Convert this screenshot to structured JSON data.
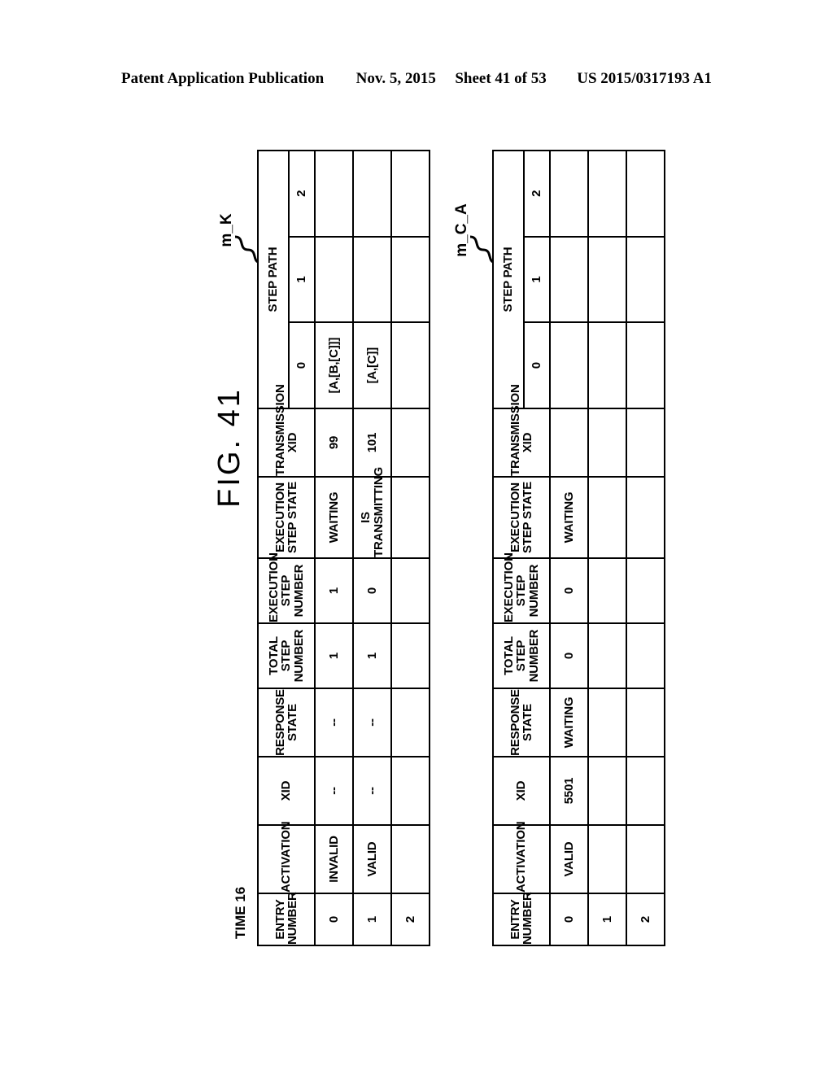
{
  "page_header": {
    "publication": "Patent Application Publication",
    "date": "Nov. 5, 2015",
    "sheet": "Sheet 41 of 53",
    "patent_number": "US 2015/0317193 A1"
  },
  "figure": {
    "title": "FIG. 41",
    "time_label": "TIME 16"
  },
  "colors": {
    "ink": "#000000",
    "paper": "#ffffff"
  },
  "tables": [
    {
      "ref_label": "m_K",
      "columns": {
        "entry_number": "ENTRY\nNUMBER",
        "activation": "ACTIVATION",
        "xid": "XID",
        "response_state": "RESPONSE\nSTATE",
        "total_step_number": "TOTAL\nSTEP\nNUMBER",
        "execution_step_number": "EXECUTION\nSTEP\nNUMBER",
        "execution_step_state": "EXECUTION\nSTEP STATE",
        "transmission_xid": "TRANSMISSION\nXID",
        "step_path": "STEP PATH",
        "step_path_sub": [
          "0",
          "1",
          "2"
        ]
      },
      "rows": [
        {
          "entry_number": "0",
          "activation": "INVALID",
          "xid": "--",
          "response_state": "--",
          "total_step_number": "1",
          "execution_step_number": "1",
          "execution_step_state": "WAITING",
          "transmission_xid": "99",
          "step_path": [
            "[A,[B,[C]]]",
            "",
            ""
          ]
        },
        {
          "entry_number": "1",
          "activation": "VALID",
          "xid": "--",
          "response_state": "--",
          "total_step_number": "1",
          "execution_step_number": "0",
          "execution_step_state": "IS\nTRANSMITTING",
          "transmission_xid": "101",
          "step_path": [
            "[A,[C]]",
            "",
            ""
          ]
        },
        {
          "entry_number": "2",
          "activation": "",
          "xid": "",
          "response_state": "",
          "total_step_number": "",
          "execution_step_number": "",
          "execution_step_state": "",
          "transmission_xid": "",
          "step_path": [
            "",
            "",
            ""
          ]
        }
      ]
    },
    {
      "ref_label": "m_C_A",
      "columns": {
        "entry_number": "ENTRY\nNUMBER",
        "activation": "ACTIVATION",
        "xid": "XID",
        "response_state": "RESPONSE\nSTATE",
        "total_step_number": "TOTAL\nSTEP\nNUMBER",
        "execution_step_number": "EXECUTION\nSTEP\nNUMBER",
        "execution_step_state": "EXECUTION\nSTEP STATE",
        "transmission_xid": "TRANSMISSION\nXID",
        "step_path": "STEP PATH",
        "step_path_sub": [
          "0",
          "1",
          "2"
        ]
      },
      "rows": [
        {
          "entry_number": "0",
          "activation": "VALID",
          "xid": "5501",
          "response_state": "WAITING",
          "total_step_number": "0",
          "execution_step_number": "0",
          "execution_step_state": "WAITING",
          "transmission_xid": "",
          "step_path": [
            "",
            "",
            ""
          ]
        },
        {
          "entry_number": "1",
          "activation": "",
          "xid": "",
          "response_state": "",
          "total_step_number": "",
          "execution_step_number": "",
          "execution_step_state": "",
          "transmission_xid": "",
          "step_path": [
            "",
            "",
            ""
          ]
        },
        {
          "entry_number": "2",
          "activation": "",
          "xid": "",
          "response_state": "",
          "total_step_number": "",
          "execution_step_number": "",
          "execution_step_state": "",
          "transmission_xid": "",
          "step_path": [
            "",
            "",
            ""
          ]
        }
      ]
    }
  ]
}
